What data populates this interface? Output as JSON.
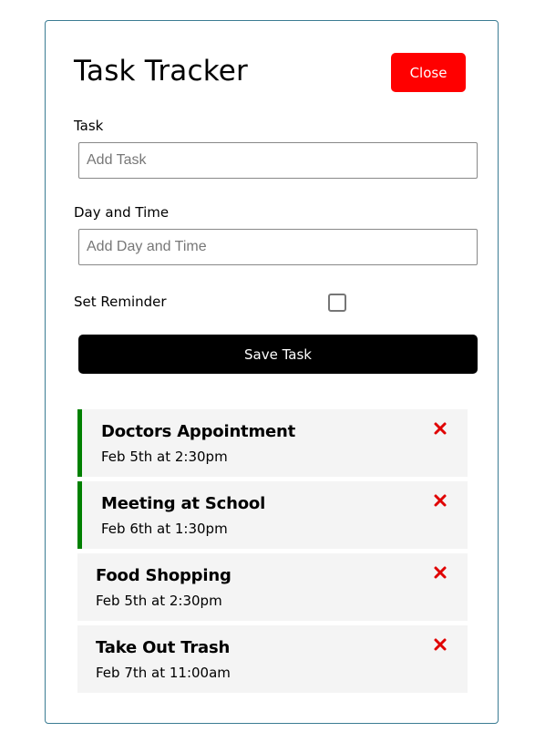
{
  "header": {
    "title": "Task Tracker",
    "close_label": "Close"
  },
  "form": {
    "task_label": "Task",
    "task_placeholder": "Add Task",
    "day_label": "Day and Time",
    "day_placeholder": "Add Day and Time",
    "reminder_label": "Set Reminder",
    "reminder_checked": false,
    "save_label": "Save Task"
  },
  "tasks": [
    {
      "text": "Doctors Appointment",
      "day": "Feb 5th at 2:30pm",
      "reminder": true
    },
    {
      "text": "Meeting at School",
      "day": "Feb 6th at 1:30pm",
      "reminder": true
    },
    {
      "text": "Food Shopping",
      "day": "Feb 5th at 2:30pm",
      "reminder": false
    },
    {
      "text": "Take Out Trash",
      "day": "Feb 7th at 11:00am",
      "reminder": false
    }
  ],
  "colors": {
    "accent_close": "#ff0000",
    "reminder_border": "#008000",
    "delete_icon": "#e00000",
    "save_button": "#000000",
    "task_background": "#f4f4f4"
  },
  "icons": {
    "delete": "x-icon"
  }
}
